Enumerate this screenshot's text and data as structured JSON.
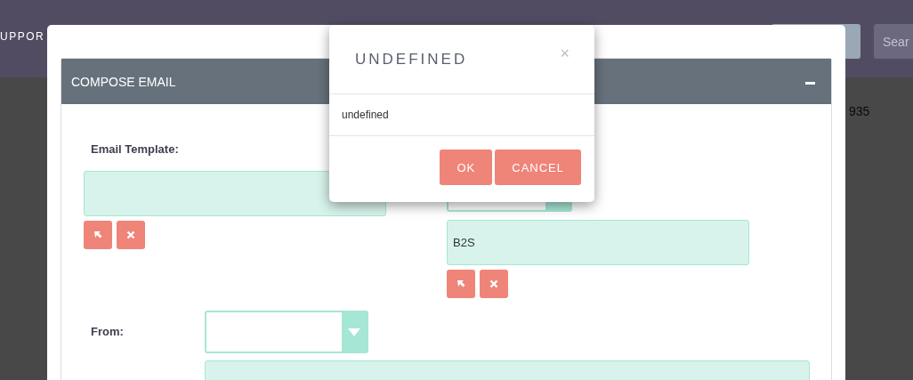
{
  "navbar": {
    "menu_item": "UPPOR",
    "search": {
      "placeholder": "Sear"
    }
  },
  "background_text": "935",
  "compose": {
    "panel_title": "COMPOSE EMAIL",
    "template_label": "Email Template:",
    "related_value": "B2S",
    "from_label": "From:"
  },
  "dialog": {
    "title": "UNDEFINED",
    "close": "×",
    "message": "undefined",
    "buttons": [
      "OK",
      "CANCEL"
    ]
  }
}
